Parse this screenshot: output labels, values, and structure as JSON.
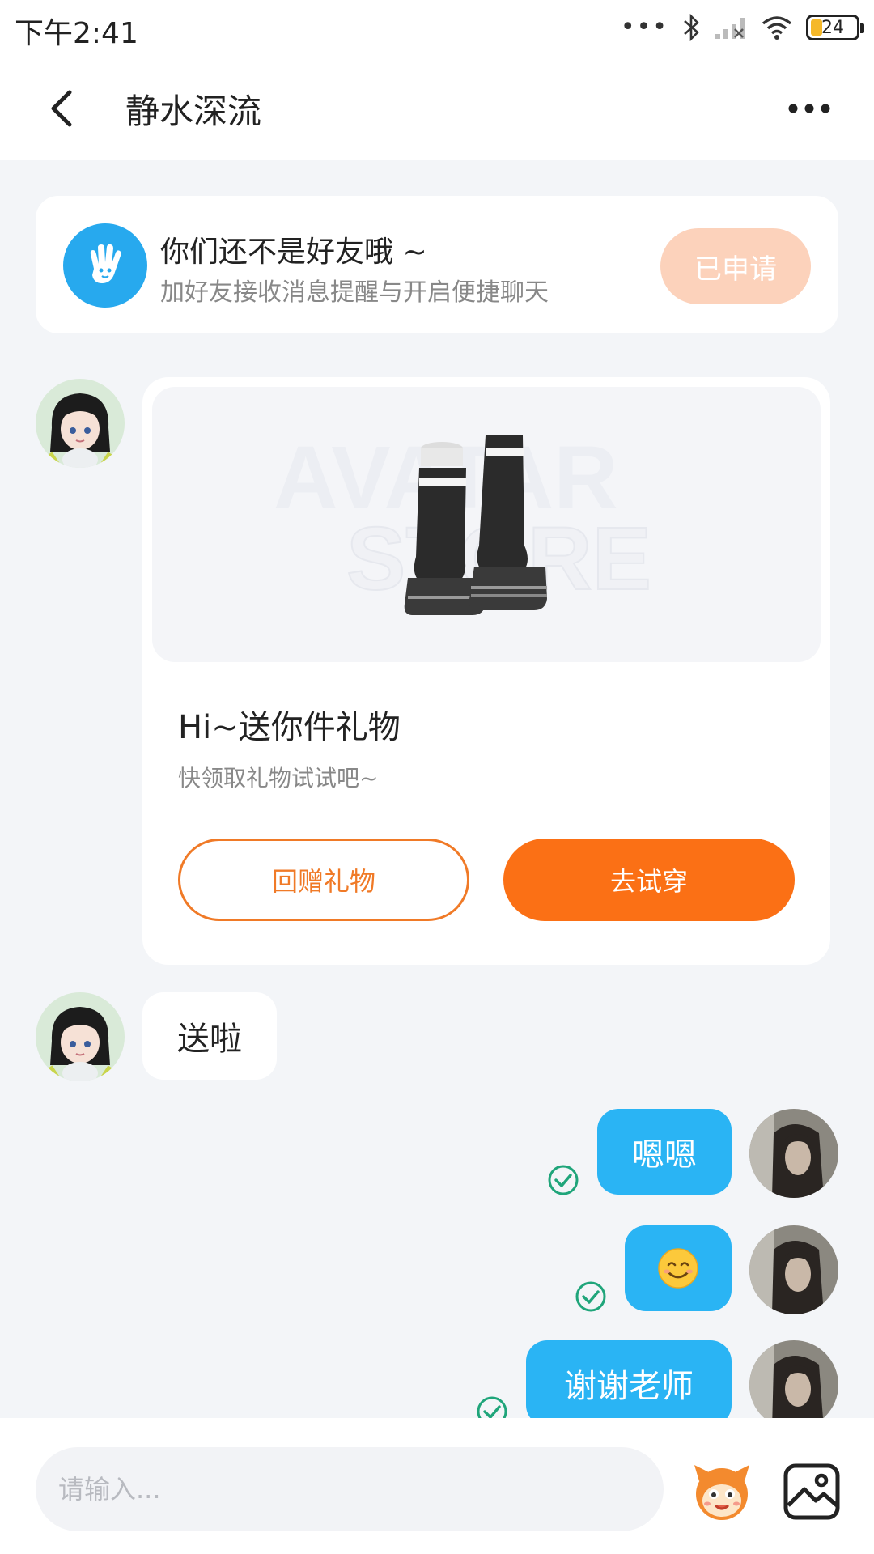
{
  "status_bar": {
    "time": "下午2:41",
    "battery": "24",
    "icons": [
      "more-dots-icon",
      "bluetooth-icon",
      "signal-icon",
      "wifi-icon",
      "battery-icon"
    ]
  },
  "header": {
    "title": "静水深流",
    "back_icon": "chevron-left-icon",
    "more_icon": "more-horizontal-icon"
  },
  "friend_notice": {
    "title": "你们还不是好友哦 ~",
    "subtitle": "加好友接收消息提醒与开启便捷聊天",
    "button_label": "已申请",
    "icon": "hand-wave-icon"
  },
  "gift_card": {
    "title": "Hi~送你件礼物",
    "subtitle": "快领取礼物试试吧~",
    "return_button": "回赠礼物",
    "try_button": "去试穿",
    "image": "boots-gift-image"
  },
  "messages": [
    {
      "side": "left",
      "text": "送啦"
    },
    {
      "side": "right",
      "text": "嗯嗯",
      "status": "read"
    },
    {
      "side": "right",
      "text": "😊",
      "status": "read"
    },
    {
      "side": "right",
      "text": "谢谢老师",
      "status": "read"
    }
  ],
  "input_bar": {
    "placeholder": "请输入...",
    "emoji_icon": "mascot-emoji-icon",
    "image_icon": "image-picker-icon"
  },
  "colors": {
    "accent_orange": "#fb7015",
    "bubble_blue": "#2ab4f4",
    "check_green": "#1fa57a",
    "page_bg": "#f3f5f8"
  }
}
